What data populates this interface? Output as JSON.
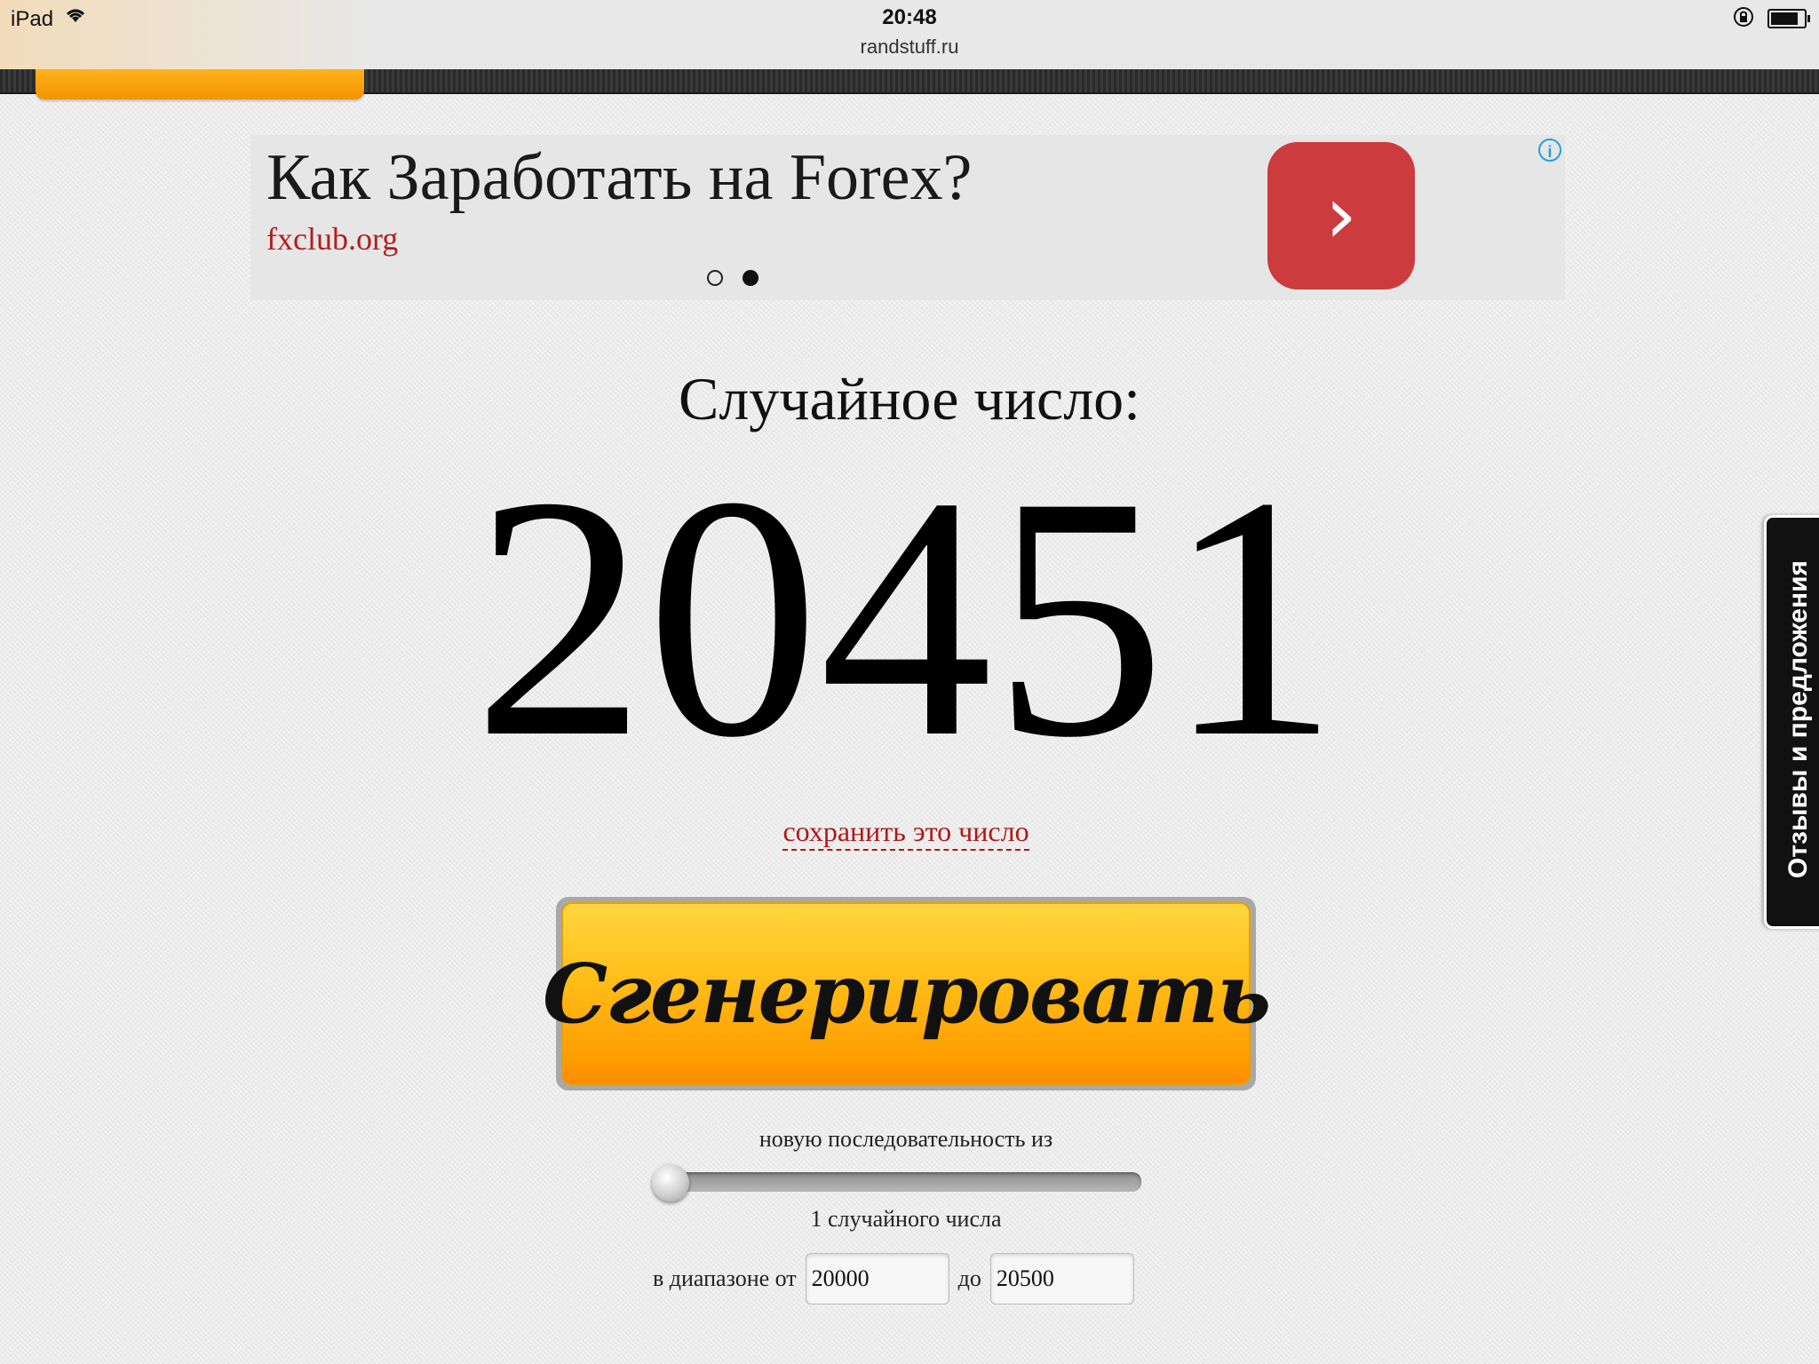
{
  "statusbar": {
    "device": "iPad",
    "wifi_icon": "wifi-icon",
    "time": "20:48",
    "url": "randstuff.ru",
    "lock_icon": "rotation-lock-icon",
    "battery_icon": "battery-icon"
  },
  "ad": {
    "title": "Как Заработать на Forex?",
    "url": "fxclub.org",
    "arrow": "›",
    "info": "i",
    "pager_index": 2,
    "pager_count": 2
  },
  "main": {
    "label": "Случайное число:",
    "number": "20451",
    "save_link": "сохранить это число",
    "generate_button": "Сгенерировать",
    "sequence_text": "новую последовательность из",
    "count_text": "1 случайного числа",
    "range_from_label": "в диапазоне от",
    "range_from_value": "20000",
    "range_to_label": "до",
    "range_to_value": "20500",
    "slider_value": 1
  },
  "feedback": {
    "label": "Отзывы и предложения"
  },
  "colors": {
    "accent_orange": "#ffa500",
    "link_red": "#b01818",
    "ad_button": "#cc3b3e"
  }
}
